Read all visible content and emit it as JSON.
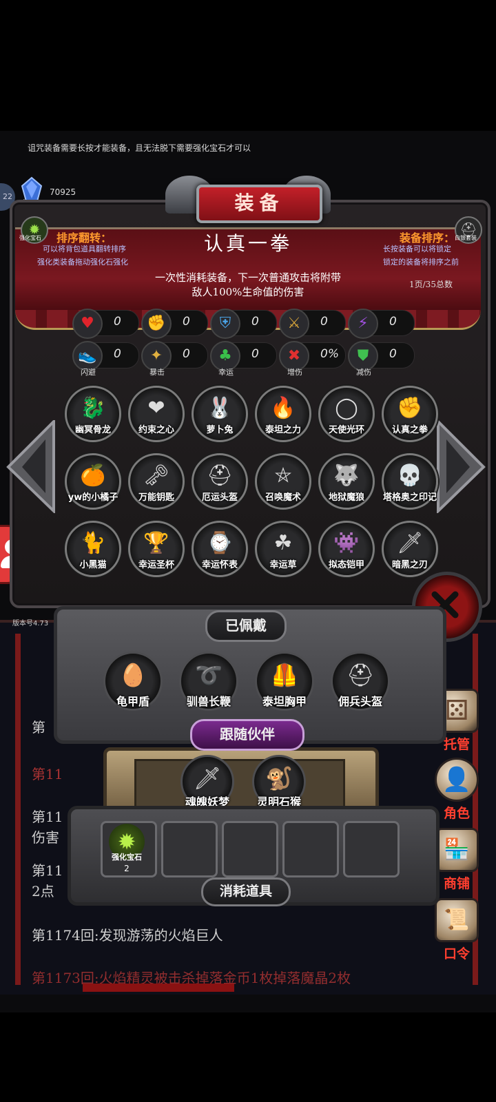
{
  "hint_text": "诅咒装备需要长按才能装备，且无法脱下需要强化宝石才可以",
  "gem": {
    "label": "宝石",
    "count": "70925",
    "level": "22"
  },
  "panel": {
    "title": "装备",
    "left_sort": {
      "icon_label": "强化宝石",
      "title": "排序翻转：",
      "line1": "可以将背包道具翻转排序",
      "line2": "强化类装备拖动强化石强化"
    },
    "right_sort": {
      "icon_label": "白银套装",
      "title": "装备排序：",
      "line1": "长按装备可以将锁定",
      "line2": "锁定的装备将排序之前"
    },
    "item_name": "认真一拳",
    "item_desc1": "一次性消耗装备，下一次普通攻击将附带",
    "item_desc2": "敌人100%生命值的伤害",
    "page_info": "1页/35总数"
  },
  "stats_row1": [
    {
      "icon": "heart-icon",
      "glyph": "♥",
      "color": "#e0242c",
      "value": "0"
    },
    {
      "icon": "strength-icon",
      "glyph": "✊",
      "color": "#e2b43a",
      "value": "0"
    },
    {
      "icon": "armor-icon",
      "glyph": "⛨",
      "color": "#4aa3e6",
      "value": "0"
    },
    {
      "icon": "sword-icon",
      "glyph": "⚔",
      "color": "#d4a23a",
      "value": "0"
    },
    {
      "icon": "lightning-icon",
      "glyph": "⚡",
      "color": "#a050e0",
      "value": "0"
    }
  ],
  "stats_row2": [
    {
      "icon": "dodge-icon",
      "glyph": "👟",
      "color": "#3a8ee0",
      "value": "0",
      "label": "闪避"
    },
    {
      "icon": "crit-icon",
      "glyph": "✦",
      "color": "#e0b040",
      "value": "0",
      "label": "暴击"
    },
    {
      "icon": "luck-icon",
      "glyph": "♣",
      "color": "#3ac04a",
      "value": "0",
      "label": "幸运"
    },
    {
      "icon": "damage-up-icon",
      "glyph": "✖",
      "color": "#e03030",
      "value": "0%",
      "label": "增伤"
    },
    {
      "icon": "damage-reduce-icon",
      "glyph": "⛊",
      "color": "#40c050",
      "value": "0",
      "label": "减伤"
    }
  ],
  "items": [
    {
      "icon": "dragon-icon",
      "glyph": "🐉",
      "name": "幽冥骨龙"
    },
    {
      "icon": "heart-gem-icon",
      "glyph": "❤",
      "name": "约束之心"
    },
    {
      "icon": "rabbit-icon",
      "glyph": "🐰",
      "name": "萝卜兔"
    },
    {
      "icon": "titan-power-icon",
      "glyph": "🔥",
      "name": "泰坦之力"
    },
    {
      "icon": "halo-icon",
      "glyph": "◯",
      "name": "天使光环"
    },
    {
      "icon": "fist-icon",
      "glyph": "✊",
      "name": "认真之拳"
    },
    {
      "icon": "orange-icon",
      "glyph": "🍊",
      "name": "yw的小橘子"
    },
    {
      "icon": "key-icon",
      "glyph": "🗝",
      "name": "万能钥匙"
    },
    {
      "icon": "helmet-icon",
      "glyph": "⛑",
      "name": "厄运头盔"
    },
    {
      "icon": "pentagram-icon",
      "glyph": "⛤",
      "name": "召唤魔术"
    },
    {
      "icon": "wolf-icon",
      "glyph": "🐺",
      "name": "地狱魔狼"
    },
    {
      "icon": "skull-icon",
      "glyph": "💀",
      "name": "塔格奥之印记"
    },
    {
      "icon": "cat-icon",
      "glyph": "🐈",
      "name": "小黑猫"
    },
    {
      "icon": "grail-icon",
      "glyph": "🏆",
      "name": "幸运圣杯"
    },
    {
      "icon": "watch-icon",
      "glyph": "⌚",
      "name": "幸运怀表"
    },
    {
      "icon": "clover-icon",
      "glyph": "☘",
      "name": "幸运草"
    },
    {
      "icon": "mimic-armor-icon",
      "glyph": "👾",
      "name": "拟态铠甲"
    },
    {
      "icon": "dark-blade-icon",
      "glyph": "🗡",
      "name": "暗黑之刃"
    }
  ],
  "version": "版本号4.73",
  "equipped": {
    "title": "已佩戴",
    "items": [
      {
        "icon": "turtle-shield-icon",
        "glyph": "🥚",
        "name": "龟甲盾"
      },
      {
        "icon": "whip-icon",
        "glyph": "➰",
        "name": "驯兽长鞭"
      },
      {
        "icon": "titan-chest-icon",
        "glyph": "🦺",
        "name": "泰坦胸甲"
      },
      {
        "icon": "merc-helmet-icon",
        "glyph": "⛑",
        "name": "佣兵头盔"
      }
    ]
  },
  "companions": {
    "title": "跟随伙伴",
    "items": [
      {
        "icon": "youmu-icon",
        "glyph": "🗡",
        "name": "魂魄妖梦"
      },
      {
        "icon": "monkey-icon",
        "glyph": "🐒",
        "name": "灵明石猴"
      }
    ]
  },
  "consumables": {
    "title": "消耗道具",
    "items": [
      {
        "icon": "enhance-gem-icon",
        "glyph": "✹",
        "name": "强化宝石",
        "count": "2"
      }
    ]
  },
  "side_menu": [
    {
      "icon": "dice-icon",
      "glyph": "⚄",
      "label": "托管"
    },
    {
      "icon": "character-icon",
      "glyph": "👤",
      "label": "角色"
    },
    {
      "icon": "shop-icon",
      "glyph": "🏪",
      "label": "商铺"
    },
    {
      "icon": "scroll-icon",
      "glyph": "📜",
      "label": "口令"
    }
  ],
  "log": [
    {
      "text": "第"
    },
    {
      "text": "第11"
    },
    {
      "text": "第11"
    },
    {
      "text": "伤害"
    },
    {
      "text": "第11"
    },
    {
      "text": "2点"
    },
    {
      "text": "第1174回:发现游荡的火焰巨人"
    },
    {
      "text": "第1173回:火焰精灵被击杀掉落金币1枚掉落魔晶2枚"
    }
  ]
}
